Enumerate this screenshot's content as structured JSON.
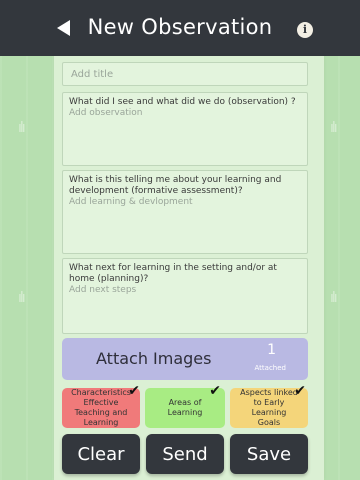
{
  "header": {
    "title": "New Observation",
    "back_icon": "back-arrow-icon",
    "info_icon": "info-icon",
    "info_glyph": "i"
  },
  "form": {
    "title_placeholder": "Add title",
    "fields": [
      {
        "question": "What did I see and what did we do (observation) ?",
        "placeholder": "Add observation"
      },
      {
        "question": "What is this telling me about your learning and development (formative assessment)?",
        "placeholder": "Add learning & devlopment"
      },
      {
        "question": "What next for learning in the setting and/or at home (planning)?",
        "placeholder": "Add next steps"
      }
    ]
  },
  "attach": {
    "label": "Attach Images",
    "count": "1",
    "count_label": "Attached"
  },
  "tags": [
    {
      "label": "Characteristics Effective Teaching and Learning",
      "checked": true,
      "color": "#f07a7a"
    },
    {
      "label": "Areas of Learning",
      "checked": true,
      "color": "#a8ec83"
    },
    {
      "label": "Aspects linked to Early Learning Goals",
      "checked": true,
      "color": "#f4d57a"
    }
  ],
  "tag_check": "✔",
  "actions": {
    "clear": "Clear",
    "send": "Send",
    "save": "Save"
  },
  "colors": {
    "header_bg": "#33373d",
    "background": "#b7dfb0",
    "panel": "#dbf0d4",
    "attach": "#b9b9e3"
  }
}
